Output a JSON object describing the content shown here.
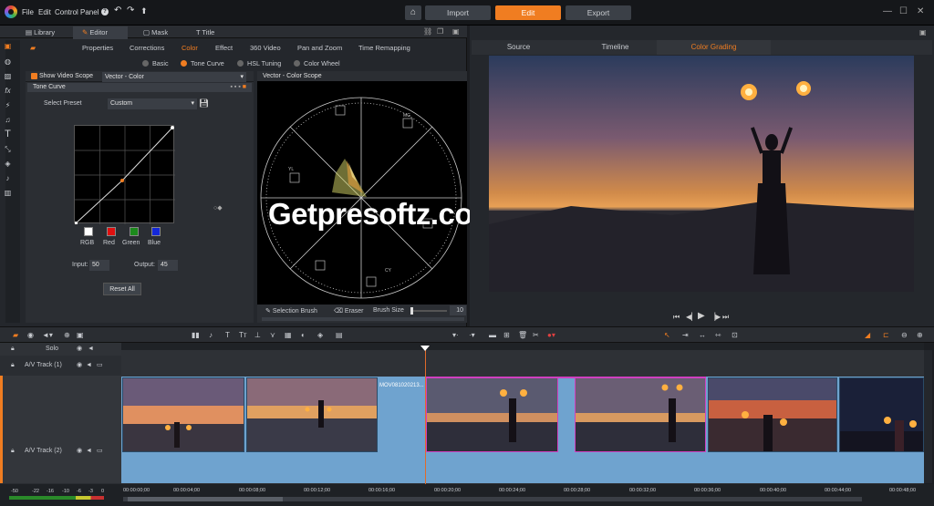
{
  "menu": {
    "file": "File",
    "edit": "Edit",
    "control_panel": "Control Panel",
    "help": "?"
  },
  "topnav": {
    "import": "Import",
    "edit": "Edit",
    "export": "Export"
  },
  "library_tabs": [
    "Library",
    "Editor",
    "Mask",
    "Title"
  ],
  "editor_tabs": [
    "Properties",
    "Corrections",
    "Color",
    "Effect",
    "360 Video",
    "Pan and Zoom",
    "Time Remapping"
  ],
  "color_modes": [
    "Basic",
    "Tone Curve",
    "HSL Tuning",
    "Color Wheel"
  ],
  "scope": {
    "show_label": "Show Video Scope",
    "type": "Vector - Color",
    "header": "Vector - Color Scope"
  },
  "tone_curve": {
    "title": "Tone Curve",
    "preset_label": "Select Preset",
    "preset_value": "Custom",
    "channels": [
      "RGB",
      "Red",
      "Green",
      "Blue"
    ],
    "input_label": "Input:",
    "input_value": "50",
    "output_label": "Output:",
    "output_value": "45",
    "reset": "Reset All"
  },
  "brush": {
    "selection": "Selection Brush",
    "eraser": "Eraser",
    "size_label": "Brush Size",
    "size_value": "10"
  },
  "preview_tabs": [
    "Source",
    "Timeline",
    "Color Grading"
  ],
  "tracks": {
    "solo": "Solo",
    "track1": "A/V Track (1)",
    "track2": "A/V Track (2)"
  },
  "clip_name": "MOV081020213...",
  "timecodes": [
    "00:00:00;00",
    "00:00:04;00",
    "00:00:08;00",
    "00:00:12;00",
    "00:00:16;00",
    "00:00:20;00",
    "00:00:24;00",
    "00:00:28;00",
    "00:00:32;00",
    "00:00:36;00",
    "00:00:40;00",
    "00:00:44;00",
    "00:00:48;00"
  ],
  "meter_ticks": [
    "-50",
    "-22",
    "-16",
    "-10",
    "-6",
    "-3",
    "0"
  ],
  "watermark": "Getpresoftz.com",
  "colors": {
    "accent": "#f07d21",
    "track_blue": "#6fa3cf"
  }
}
